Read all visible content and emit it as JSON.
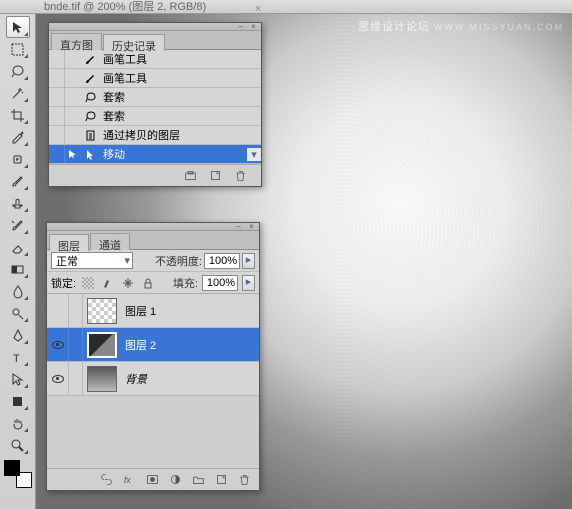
{
  "titlebar": {
    "text": "bnde.tif @ 200% (图层 2, RGB/8)"
  },
  "watermark": {
    "main": "思缘设计论坛",
    "sub": "WWW.MISSYUAN.COM"
  },
  "tools": [
    {
      "name": "move-tool",
      "sel": true
    },
    {
      "name": "marquee-tool"
    },
    {
      "name": "lasso-tool"
    },
    {
      "name": "wand-tool"
    },
    {
      "name": "crop-tool"
    },
    {
      "name": "eyedropper-tool"
    },
    {
      "name": "healing-tool"
    },
    {
      "name": "brush-tool"
    },
    {
      "name": "stamp-tool"
    },
    {
      "name": "history-brush-tool"
    },
    {
      "name": "eraser-tool"
    },
    {
      "name": "gradient-tool"
    },
    {
      "name": "blur-tool"
    },
    {
      "name": "dodge-tool"
    },
    {
      "name": "pen-tool"
    },
    {
      "name": "type-tool"
    },
    {
      "name": "path-select-tool"
    },
    {
      "name": "shape-tool"
    },
    {
      "name": "hand-tool"
    },
    {
      "name": "zoom-tool"
    }
  ],
  "history": {
    "tabs": {
      "histogram": "直方图",
      "history": "历史记录"
    },
    "items": [
      {
        "icon": "brush",
        "label": "画笔工具"
      },
      {
        "icon": "brush",
        "label": "画笔工具"
      },
      {
        "icon": "lasso",
        "label": "套索"
      },
      {
        "icon": "lasso",
        "label": "套索"
      },
      {
        "icon": "copy-layer",
        "label": "通过拷贝的图层"
      },
      {
        "icon": "move",
        "label": "移动",
        "sel": true
      }
    ]
  },
  "layers": {
    "tabs": {
      "layers": "图层",
      "channels": "通道"
    },
    "blend_label": "正常",
    "opacity_label": "不透明度:",
    "opacity_value": "100%",
    "lock_label": "锁定:",
    "fill_label": "填充:",
    "fill_value": "100%",
    "items": [
      {
        "name": "图层 1",
        "thumb": "checker",
        "vis": false
      },
      {
        "name": "图层 2",
        "thumb": "dark",
        "vis": true,
        "sel": true
      },
      {
        "name": "背景",
        "thumb": "bw",
        "vis": true,
        "italic": true
      }
    ]
  }
}
